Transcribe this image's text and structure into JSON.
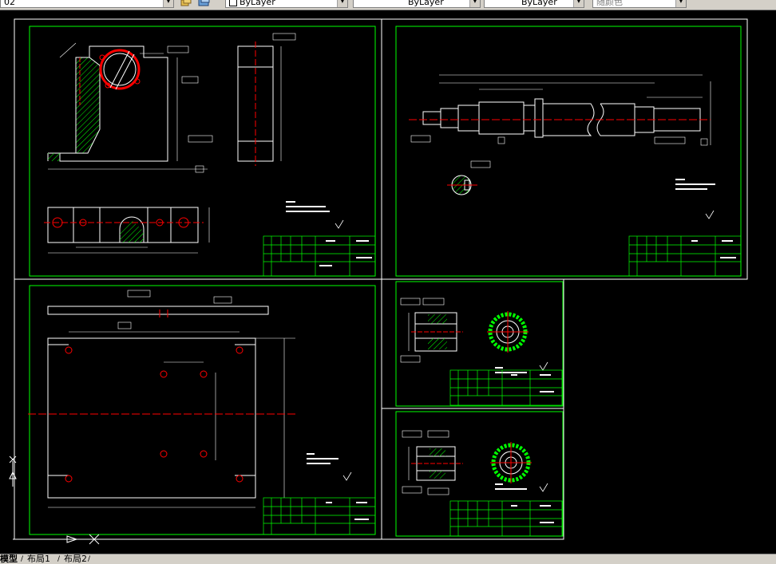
{
  "toolbar": {
    "layer_combo": "02",
    "color_combo": "ByLayer",
    "linetype_combo": "ByLayer",
    "lineweight_combo": "ByLayer",
    "plotstyle_combo": "随颜色"
  },
  "layout_tabs": [
    {
      "label": "模型",
      "active": true
    },
    {
      "label": "布局1",
      "active": false
    },
    {
      "label": "布局2",
      "active": false
    }
  ],
  "icons": {
    "layer_state": "layer-state-icon",
    "layer_prev": "layer-previous-icon",
    "ucs": "ucs-icon"
  },
  "colors": {
    "background": "#000000",
    "border": "#00ff00",
    "geometry": "#ffffff",
    "center": "#ff0000",
    "hatch": "#00ff00",
    "dim": "#00ff00",
    "ui_gray": "#d4d0c8"
  }
}
